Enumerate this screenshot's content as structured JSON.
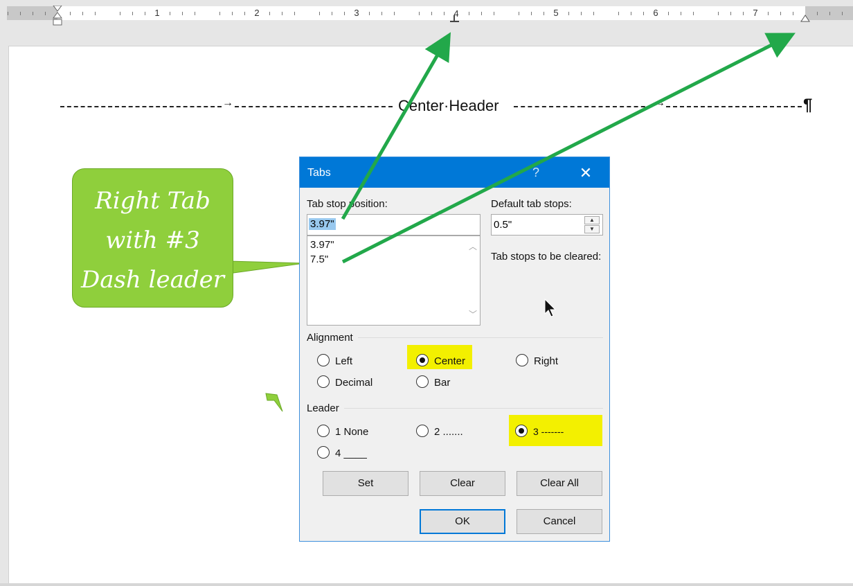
{
  "ruler": {
    "numbers": [
      "1",
      "2",
      "3",
      "4",
      "5",
      "6",
      "7"
    ]
  },
  "document": {
    "header_text": "Center·Header",
    "tab_arrow": "→",
    "paragraph_mark": "¶"
  },
  "callout": {
    "line1": "Right Tab",
    "line2": "with #3",
    "line3": "Dash leader"
  },
  "dialog": {
    "title": "Tabs",
    "help": "?",
    "close": "✕",
    "tab_stop_position_label": "Tab stop position:",
    "tab_stop_position_value": "3.97\"",
    "tab_stops": [
      "3.97\"",
      "7.5\""
    ],
    "default_tab_stops_label": "Default tab stops:",
    "default_tab_stops_value": "0.5\"",
    "to_be_cleared_label": "Tab stops to be cleared:",
    "alignment_label": "Alignment",
    "alignment_options": [
      "Left",
      "Center",
      "Right",
      "Decimal",
      "Bar"
    ],
    "alignment_selected": "Center",
    "leader_label": "Leader",
    "leader_options": [
      "1 None",
      "2 .......",
      "3 -------",
      "4 ____"
    ],
    "leader_selected": "3 -------",
    "buttons": {
      "set": "Set",
      "clear": "Clear",
      "clear_all": "Clear All",
      "ok": "OK",
      "cancel": "Cancel"
    }
  },
  "colors": {
    "titlebar": "#0078d7",
    "highlight": "#f3f000",
    "callout": "#8fcf3c",
    "arrow": "#22a84a"
  }
}
